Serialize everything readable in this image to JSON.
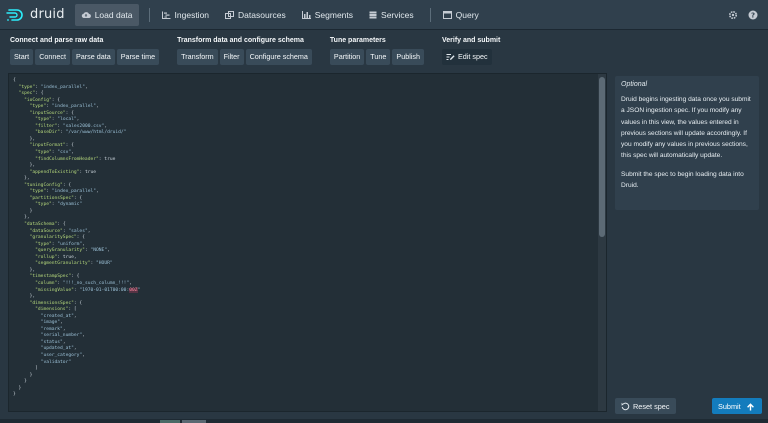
{
  "app": {
    "name": "druid"
  },
  "nav": {
    "items": [
      {
        "label": "Load data",
        "icon": "cloud-upload-icon",
        "active": true
      },
      {
        "label": "Ingestion",
        "icon": "gantt-chart-icon"
      },
      {
        "label": "Datasources",
        "icon": "multi-select-icon"
      },
      {
        "label": "Segments",
        "icon": "stacked-chart-icon"
      },
      {
        "label": "Services",
        "icon": "database-icon"
      },
      {
        "label": "Query",
        "icon": "application-icon"
      }
    ],
    "right_icons": [
      "gear-icon",
      "help-icon"
    ]
  },
  "steps": {
    "groups": [
      {
        "title": "Connect and parse raw data",
        "buttons": [
          "Start",
          "Connect",
          "Parse data",
          "Parse time"
        ]
      },
      {
        "title": "Transform data and configure schema",
        "buttons": [
          "Transform",
          "Filter",
          "Configure schema"
        ]
      },
      {
        "title": "Tune parameters",
        "buttons": [
          "Partition",
          "Tune",
          "Publish"
        ]
      },
      {
        "title": "Verify and submit",
        "buttons": [
          "Edit spec"
        ]
      }
    ]
  },
  "spec_lines": [
    "{",
    "  \"type\": \"index_parallel\",",
    "  \"spec\": {",
    "    \"ioConfig\": {",
    "      \"type\": \"index_parallel\",",
    "      \"inputSource\": {",
    "        \"type\": \"local\",",
    "        \"filter\": \"sales2000.csv\",",
    "        \"baseDir\": \"/var/www/html/druid/\"",
    "      },",
    "      \"inputFormat\": {",
    "        \"type\": \"csv\",",
    "        \"findColumnsFromHeader\": true",
    "      },",
    "      \"appendToExisting\": true",
    "    },",
    "    \"tuningConfig\": {",
    "      \"type\": \"index_parallel\",",
    "      \"partitionsSpec\": {",
    "        \"type\": \"dynamic\"",
    "      }",
    "    },",
    "    \"dataSchema\": {",
    "      \"dataSource\": \"sales\",",
    "      \"granularitySpec\": {",
    "        \"type\": \"uniform\",",
    "        \"queryGranularity\": \"NONE\",",
    "        \"rollup\": true,",
    "        \"segmentGranularity\": \"HOUR\"",
    "      },",
    "      \"timestampSpec\": {",
    "        \"column\": \"!!!_no_such_column_!!!\",",
    "        \"missingValue\": \"1970-01-01T00:00:00Z\"",
    "      },",
    "      \"dimensionsSpec\": {",
    "        \"dimensions\": [",
    "          \"created_at\",",
    "          \"image\",",
    "          \"remark\",",
    "          \"serial_number\",",
    "          \"status\",",
    "          \"updated_at\",",
    "          \"user_category\",",
    "          \"validator\"",
    "        ]",
    "      }",
    "    }",
    "  }",
    "}"
  ],
  "info": {
    "title": "Optional",
    "paragraph1": "Druid begins ingesting data once you submit a JSON ingestion spec. If you modify any values in this view, the values entered in previous sections will update accordingly. If you modify any values in previous sections, this spec will automatically update.",
    "paragraph2": "Submit the spec to begin loading data into Druid."
  },
  "actions": {
    "reset_label": "Reset spec",
    "submit_label": "Submit"
  },
  "colors": {
    "accent": "#137cbd",
    "background": "#293742",
    "navbar": "#30404d",
    "editor": "#232f37",
    "key": "#b6d97c",
    "string": "#9bc0d6"
  }
}
